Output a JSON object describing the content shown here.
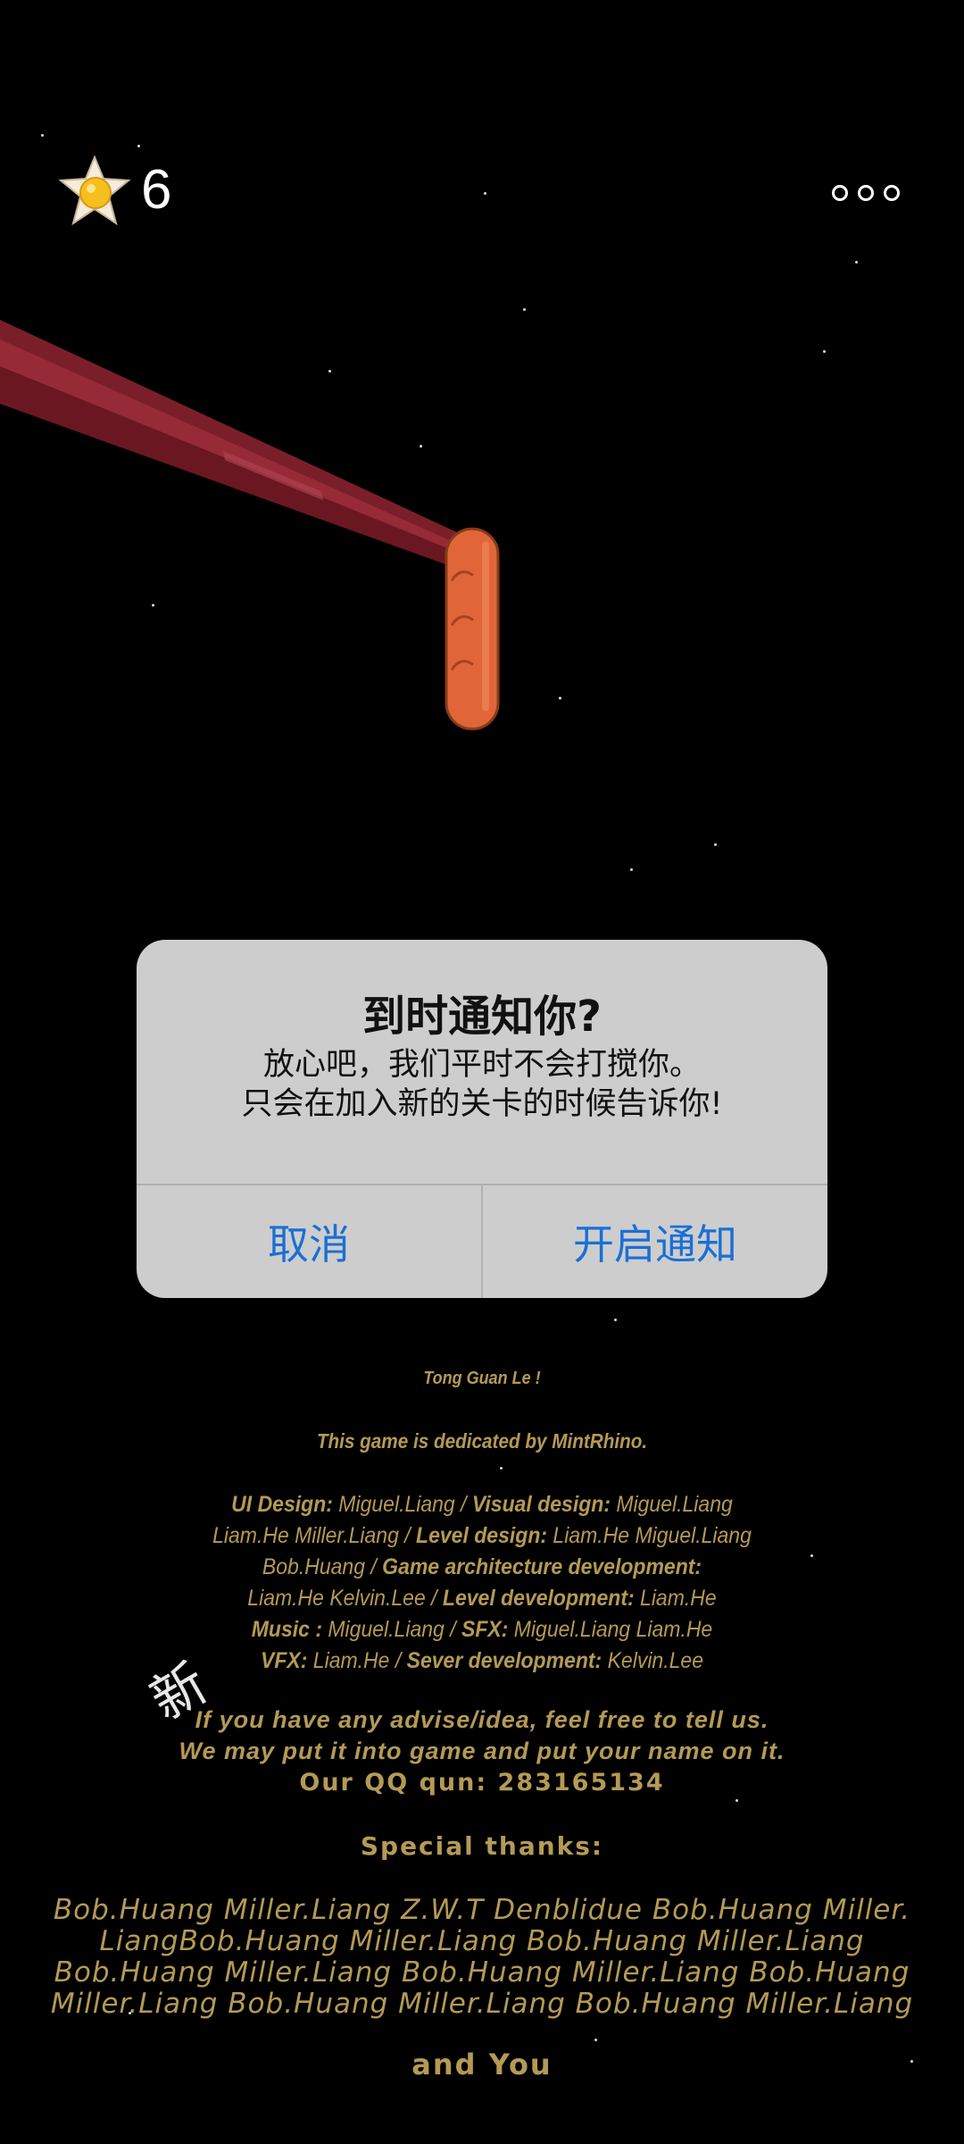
{
  "hud": {
    "egg_icon": "fried-egg-star-icon",
    "count": "6",
    "menu_icon": "three-dots-icon"
  },
  "dialog": {
    "title": "到时通知你?",
    "message_line1": "放心吧，我们平时不会打搅你。",
    "message_line2": "只会在加入新的关卡的时候告诉你!",
    "cancel_label": "取消",
    "confirm_label": "开启通知",
    "accent_color": "#1a6fd6"
  },
  "credits": {
    "title": "Tong Guan Le !",
    "dedication": "This game is dedicated by MintRhino.",
    "row1": {
      "l1": "UI Design:",
      "v1": " Miguel.Liang / ",
      "l2": "Visual design:",
      "v2": " Miguel.Liang"
    },
    "row2": {
      "v1": "Liam.He Miller.Liang / ",
      "l1": "Level design:",
      "v2": " Liam.He Miguel.Liang"
    },
    "row3": {
      "v1": "Bob.Huang /  ",
      "l1": "Game architecture development:"
    },
    "row4": {
      "v1": "Liam.He Kelvin.Lee / ",
      "l1": "Level development:",
      "v2": " Liam.He"
    },
    "row5": {
      "l1": "Music :",
      "v1": " Miguel.Liang / ",
      "l2": "SFX:",
      "v2": " Miguel.Liang Liam.He"
    },
    "row6": {
      "l1": "VFX:",
      "v1": " Liam.He / ",
      "l2": "Sever development:",
      "v2": " Kelvin.Lee"
    },
    "advise1": "If you have any advise/idea, feel free to tell us.",
    "advise2": "We may put it into game and put your name on it.",
    "qq": "Our QQ qun: 283165134",
    "thanks_heading": "Special thanks:",
    "thanks1": "Bob.Huang Miller.Liang Z.W.T Denblidue Bob.Huang Miller.",
    "thanks2": "LiangBob.Huang Miller.Liang Bob.Huang Miller.Liang",
    "thanks3": "Bob.Huang Miller.Liang Bob.Huang Miller.Liang Bob.Huang",
    "thanks4": "Miller.Liang Bob.Huang Miller.Liang Bob.Huang Miller.Liang",
    "closing": "and You",
    "text_color": "#b49a55"
  },
  "overlay_glyph": "新"
}
